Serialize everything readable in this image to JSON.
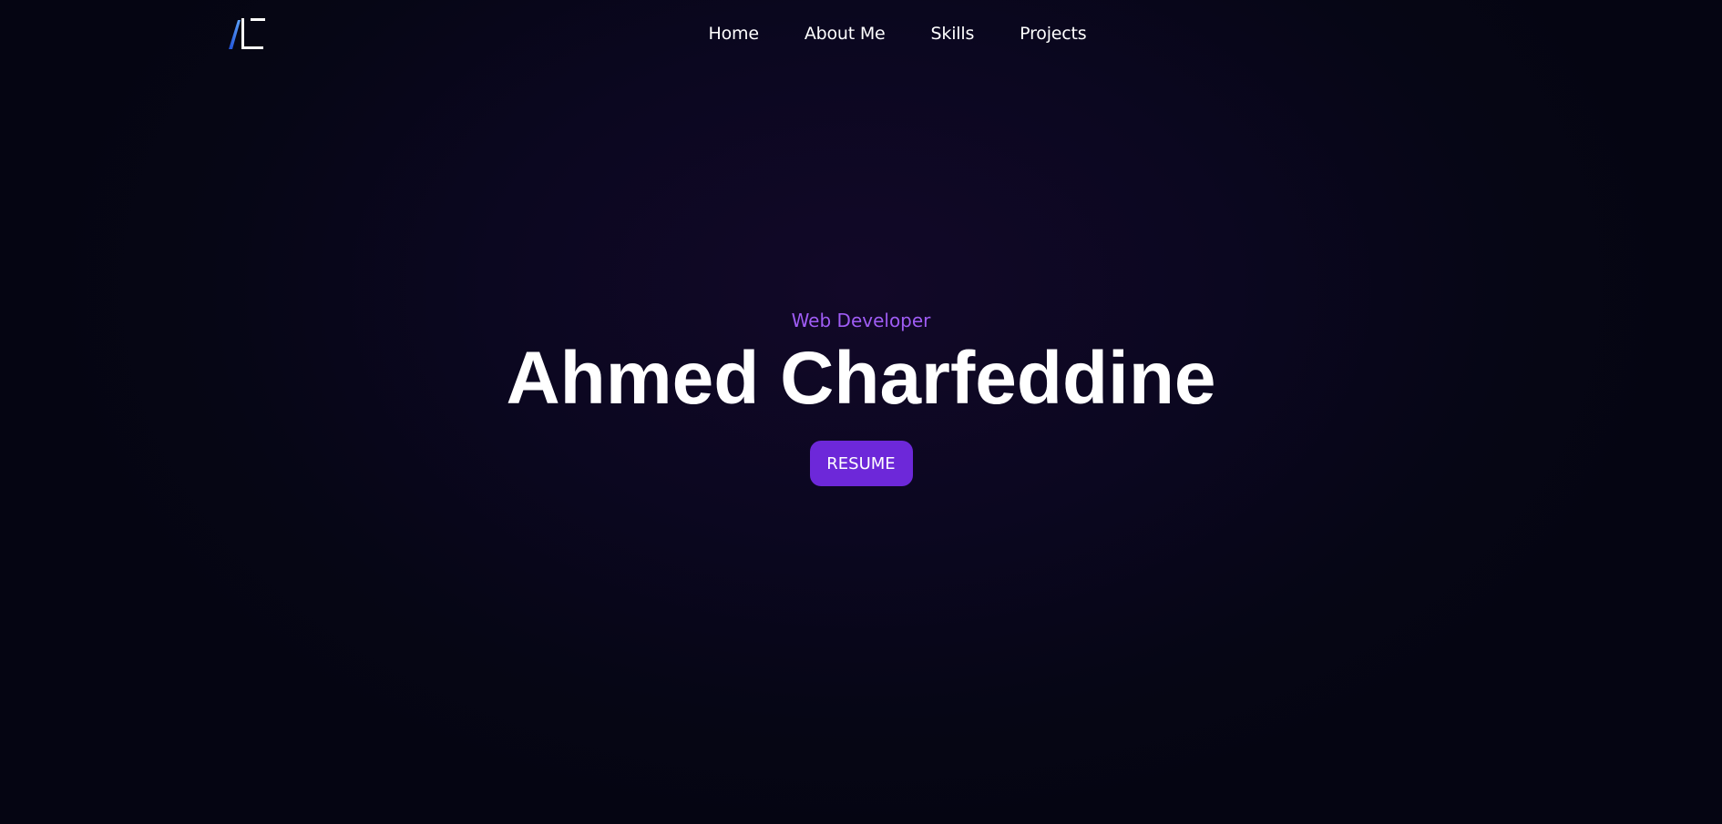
{
  "nav": {
    "logo_icon": "ac-logo-icon",
    "links": [
      {
        "label": "Home"
      },
      {
        "label": "About Me"
      },
      {
        "label": "Skills"
      },
      {
        "label": "Projects"
      }
    ]
  },
  "hero": {
    "subtitle": "Web Developer",
    "name": "Ahmed Charfeddine",
    "resume_label": "RESUME"
  },
  "colors": {
    "background": "#0a0720",
    "accent": "#9f5cf4",
    "button": "#6d28d9",
    "logo_blue": "#3b82f6",
    "text": "#ffffff"
  }
}
